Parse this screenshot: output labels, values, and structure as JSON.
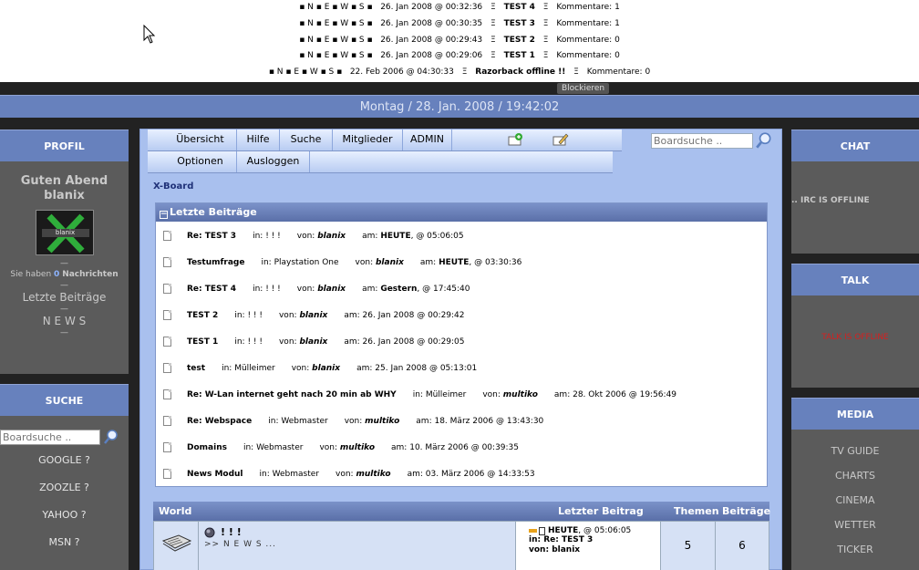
{
  "news_ticker": [
    {
      "prefix": "▪ N ▪ E ▪ W ▪ S ▪",
      "date": "26. Jan 2008 @ 00:32:36",
      "title": "TEST 4",
      "comments": "Kommentare: 1"
    },
    {
      "prefix": "▪ N ▪ E ▪ W ▪ S ▪",
      "date": "26. Jan 2008 @ 00:30:35",
      "title": "TEST 3",
      "comments": "Kommentare: 1"
    },
    {
      "prefix": "▪ N ▪ E ▪ W ▪ S ▪",
      "date": "26. Jan 2008 @ 00:29:43",
      "title": "TEST 2",
      "comments": "Kommentare: 0"
    },
    {
      "prefix": "▪ N ▪ E ▪ W ▪ S ▪",
      "date": "26. Jan 2008 @ 00:29:06",
      "title": "TEST 1",
      "comments": "Kommentare: 0"
    },
    {
      "prefix": "▪ N ▪ E ▪ W ▪ S ▪",
      "date": "22. Feb 2006 @ 04:30:33",
      "title": "Razorback offline !!",
      "comments": "Kommentare: 0"
    }
  ],
  "ticker_sep": "Ξ",
  "block_button": "Blockieren",
  "datebar": "Montag / 28. Jan. 2008 / 19:42:02",
  "profil": {
    "title": "PROFIL",
    "greeting1": "Guten Abend",
    "greeting2": "blanix",
    "avatar_text": "blanix",
    "dash": "—",
    "msg_pre": "Sie haben",
    "msg_count": "0",
    "msg_post": "Nachrichten",
    "letzte": "Letzte Beiträge",
    "news": "N E W S"
  },
  "suche": {
    "title": "SUCHE",
    "placeholder": "Boardsuche ..",
    "links": [
      "GOOGLE ?",
      "ZOOZLE ?",
      "YAHOO ?",
      "MSN ?"
    ]
  },
  "chat": {
    "title": "CHAT",
    "status": ".. IRC IS OFFLINE"
  },
  "talk": {
    "title": "TALK",
    "status": "TALK IS OFFLINE"
  },
  "media": {
    "title": "MEDIA",
    "links": [
      "TV GUIDE",
      "CHARTS",
      "CINEMA",
      "WETTER",
      "TICKER"
    ]
  },
  "nav": {
    "tabs1": [
      "Übersicht",
      "Hilfe",
      "Suche",
      "Mitglieder",
      "ADMIN"
    ],
    "tabs2": [
      "Optionen",
      "Ausloggen"
    ],
    "search_placeholder": "Boardsuche .."
  },
  "breadcrumb": "X-Board",
  "latest": {
    "title": "Letzte Beiträge",
    "in_label": "in:",
    "von_label": "von:",
    "am_label": "am:",
    "rows": [
      {
        "title": "Re: TEST 3",
        "forum": "! ! !",
        "user": "blanix",
        "date_bold": "HEUTE",
        "date": ", @ 05:06:05"
      },
      {
        "title": "Testumfrage",
        "forum": "Playstation One",
        "user": "blanix",
        "date_bold": "HEUTE",
        "date": ", @ 03:30:36"
      },
      {
        "title": "Re: TEST 4",
        "forum": "! ! !",
        "user": "blanix",
        "date_bold": "Gestern",
        "date": ", @ 17:45:40"
      },
      {
        "title": "TEST 2",
        "forum": "! ! !",
        "user": "blanix",
        "date_bold": "",
        "date": "26. Jan 2008 @ 00:29:42"
      },
      {
        "title": "TEST 1",
        "forum": "! ! !",
        "user": "blanix",
        "date_bold": "",
        "date": "26. Jan 2008 @ 00:29:05"
      },
      {
        "title": "test",
        "forum": "Mülleimer",
        "user": "blanix",
        "date_bold": "",
        "date": "25. Jan 2008 @ 05:13:01"
      },
      {
        "title": "Re: W-Lan internet geht nach 20 min ab WHY",
        "forum": "Mülleimer",
        "user": "multiko",
        "date_bold": "",
        "date": "28. Okt 2006 @ 19:56:49"
      },
      {
        "title": "Re: Webspace",
        "forum": "Webmaster",
        "user": "multiko",
        "date_bold": "",
        "date": "18. März 2006 @ 13:43:30"
      },
      {
        "title": "Domains",
        "forum": "Webmaster",
        "user": "multiko",
        "date_bold": "",
        "date": "10. März 2006 @ 00:39:35"
      },
      {
        "title": "News Modul",
        "forum": "Webmaster",
        "user": "multiko",
        "date_bold": "",
        "date": "03. März 2006 @ 14:33:53"
      }
    ]
  },
  "world": {
    "title": "World",
    "col_last": "Letzter Beitrag",
    "col_themen": "Themen",
    "col_beitraege": "Beiträge",
    "forum_name": "! ! !",
    "forum_desc": ">> N E W S ...",
    "last_date_bold": "HEUTE",
    "last_date": ", @ 05:06:05",
    "last_in": "in: Re: TEST 3",
    "last_von": "von: blanix",
    "themen": "5",
    "beitraege": "6"
  },
  "colors": {
    "header_blue": "#6781bd",
    "panel_grey": "#5b5b5b",
    "main_blue": "#a9c0ee",
    "offline_red": "#d42020"
  }
}
